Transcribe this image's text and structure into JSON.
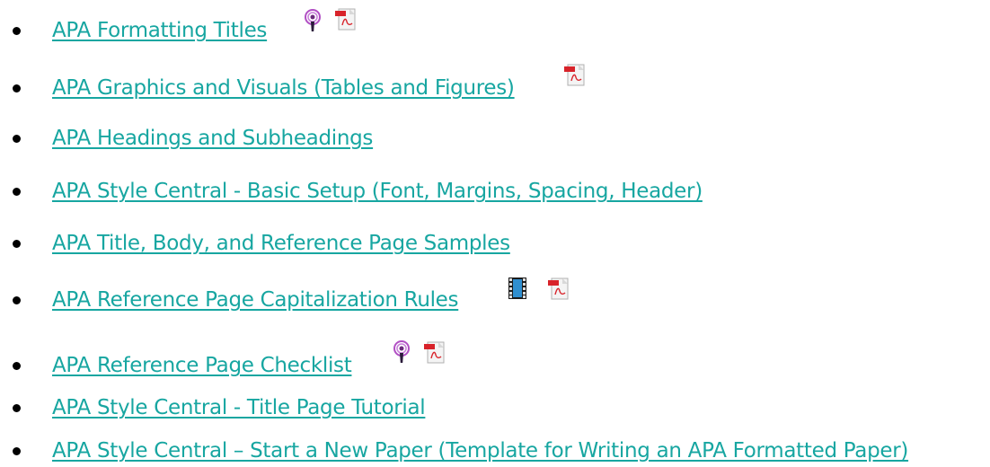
{
  "items": [
    {
      "label": "APA Formatting Titles",
      "icons": [
        "podcast-icon",
        "pdf-icon"
      ]
    },
    {
      "label": "APA Graphics and Visuals (Tables and Figures)",
      "icons": [
        "pdf-icon"
      ]
    },
    {
      "label": "APA Headings and Subheadings",
      "icons": []
    },
    {
      "label": "APA Style Central - Basic Setup (Font, Margins, Spacing, Header)",
      "icons": []
    },
    {
      "label": "APA Title, Body, and Reference Page Samples",
      "icons": []
    },
    {
      "label": "APA Reference Page Capitalization Rules",
      "icons": [
        "video-icon",
        "pdf-icon"
      ]
    },
    {
      "label": "APA Reference Page Checklist",
      "icons": [
        "podcast-icon",
        "pdf-icon"
      ]
    },
    {
      "label": "APA Style Central - Title Page Tutorial",
      "icons": []
    },
    {
      "label": "APA Style Central – Start a New Paper (Template for Writing an APA Formatted Paper)",
      "icons": []
    }
  ],
  "colors": {
    "link": "#17a6a1",
    "bullet": "#000000"
  }
}
